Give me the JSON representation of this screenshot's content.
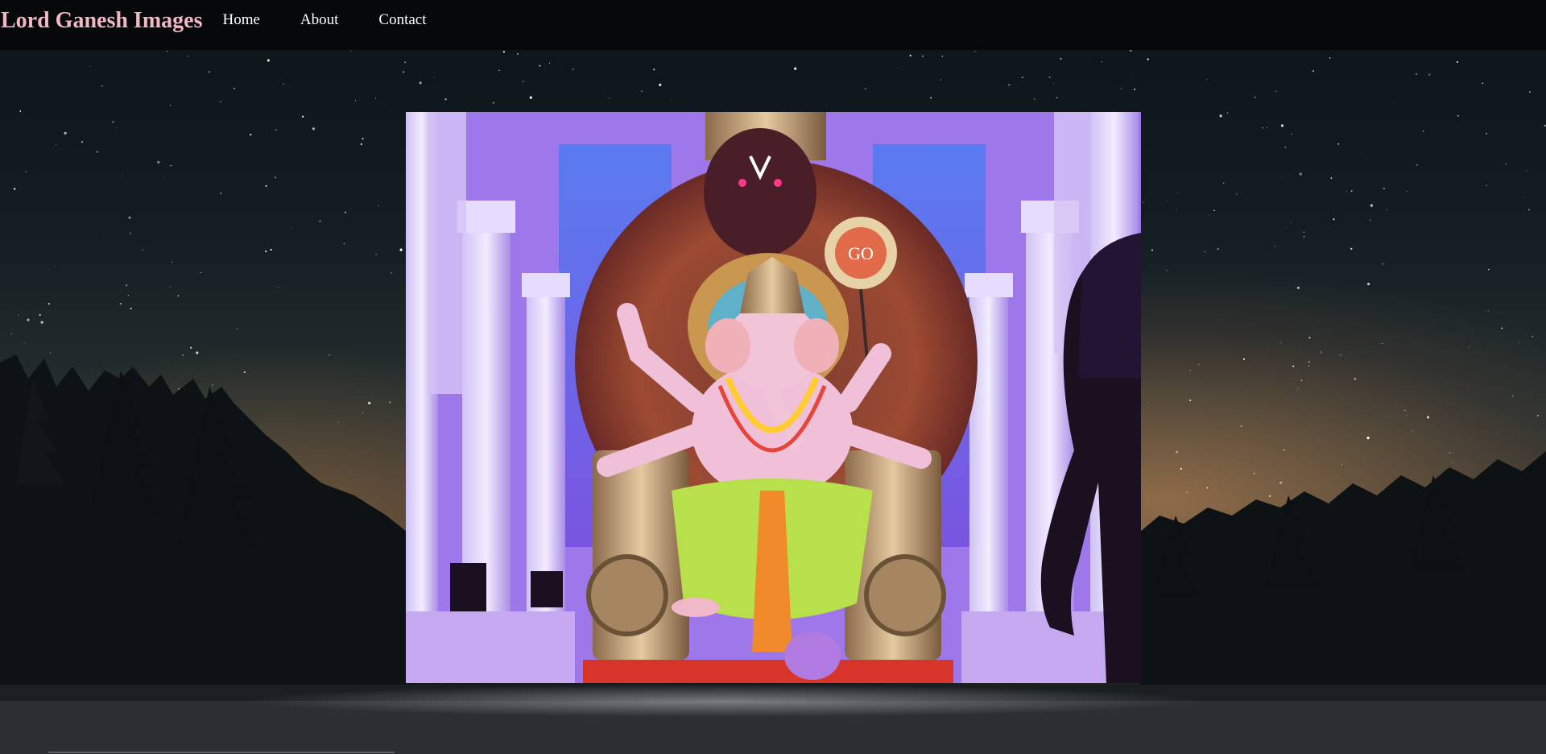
{
  "navbar": {
    "brand": "Lord Ganesh Images",
    "links": [
      {
        "label": "Home"
      },
      {
        "label": "About"
      },
      {
        "label": "Contact"
      }
    ]
  },
  "hero": {
    "sign_text": "GO"
  },
  "colors": {
    "brand": "#f2b7c4",
    "navbar_bg": "#06080a",
    "link": "#ffffff"
  }
}
